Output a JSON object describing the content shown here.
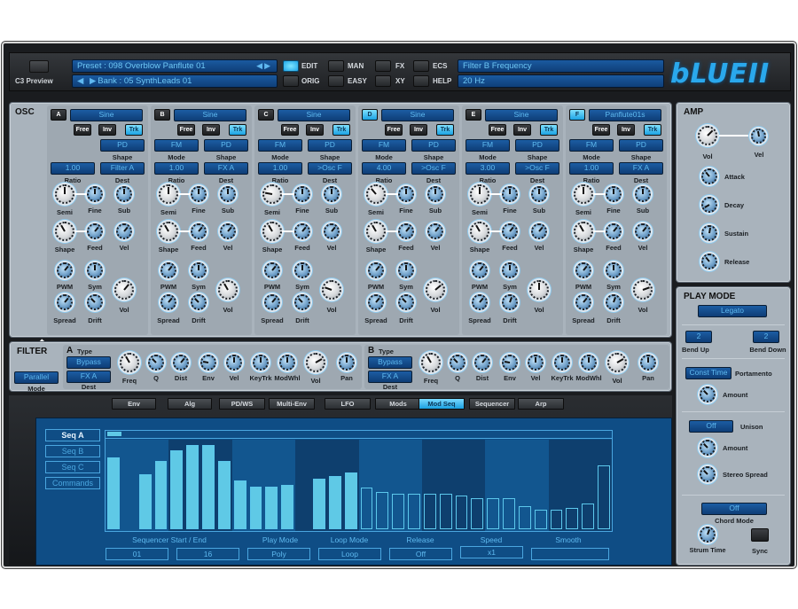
{
  "header": {
    "c3_preview_label": "C3 Preview",
    "preset": "Preset : 098 Overblow Panflute 01",
    "bank": "Bank : 05 SynthLeads 01",
    "mode_buttons": [
      {
        "label": "EDIT",
        "active": true
      },
      {
        "label": "ORIG",
        "active": false
      },
      {
        "label": "MAN",
        "active": false
      },
      {
        "label": "EASY",
        "active": false
      },
      {
        "label": "FX",
        "active": false
      },
      {
        "label": "XY",
        "active": false
      },
      {
        "label": "ECS",
        "active": false
      },
      {
        "label": "HELP",
        "active": false
      }
    ],
    "param_name": "Filter B Frequency",
    "param_value": "20 Hz",
    "logo": "bLUEII"
  },
  "osc": {
    "title": "OSC",
    "labels": {
      "free": "Free",
      "inv": "Inv",
      "trk": "Trk",
      "mode": "Mode",
      "shape": "Shape",
      "ratio": "Ratio",
      "dest": "Dest",
      "knobs": [
        "Semi",
        "Fine",
        "Sub",
        "Shape",
        "Feed",
        "Vel",
        "PWM",
        "Sym",
        "Vol",
        "Spread",
        "Drift"
      ]
    },
    "oscillators": [
      {
        "letter": "A",
        "active": false,
        "wave": "Sine",
        "mode": "",
        "shape": "PD",
        "ratio": "1.00",
        "dest": "Filter A"
      },
      {
        "letter": "B",
        "active": false,
        "wave": "Sine",
        "mode": "FM",
        "shape": "PD",
        "ratio": "1.00",
        "dest": "FX A"
      },
      {
        "letter": "C",
        "active": false,
        "wave": "Sine",
        "mode": "FM",
        "shape": "PD",
        "ratio": "1.00",
        "dest": ">Osc F"
      },
      {
        "letter": "D",
        "active": true,
        "wave": "Sine",
        "mode": "FM",
        "shape": "PD",
        "ratio": "4.00",
        "dest": ">Osc F"
      },
      {
        "letter": "E",
        "active": false,
        "wave": "Sine",
        "mode": "FM",
        "shape": "PD",
        "ratio": "3.00",
        "dest": ">Osc F"
      },
      {
        "letter": "F",
        "active": true,
        "wave": "Panflute01s",
        "mode": "FM",
        "shape": "PD",
        "ratio": "1.00",
        "dest": "FX A"
      }
    ]
  },
  "filter": {
    "title": "FILTER",
    "mode_value": "Parallel",
    "mode_label": "Mode",
    "type_label": "Type",
    "dest_label": "Dest",
    "sections": [
      {
        "letter": "A",
        "type": "Bypass",
        "dest": "FX A"
      },
      {
        "letter": "B",
        "type": "Bypass",
        "dest": "FX A"
      }
    ],
    "knobs": [
      "Freq",
      "Q",
      "Dist",
      "Env",
      "Vel",
      "KeyTrk",
      "ModWhl",
      "Vol",
      "Pan"
    ]
  },
  "tabs": [
    {
      "label": "Env",
      "active": false
    },
    {
      "label": "Alg",
      "active": false
    },
    {
      "label": "PD/WS",
      "active": false
    },
    {
      "label": "Multi-Env",
      "active": false
    },
    {
      "label": "LFO",
      "active": false
    },
    {
      "label": "Mods",
      "active": false
    },
    {
      "label": "Mod Seq",
      "active": true
    },
    {
      "label": "Sequencer",
      "active": false
    },
    {
      "label": "Arp",
      "active": false
    }
  ],
  "mod_seq": {
    "seq_buttons": [
      {
        "label": "Seq A",
        "active": true
      },
      {
        "label": "Seq B",
        "active": false
      },
      {
        "label": "Seq C",
        "active": false
      },
      {
        "label": "Commands",
        "active": false
      }
    ],
    "steps_active": 16,
    "step_values": [
      0.82,
      0,
      0.63,
      0.78,
      0.9,
      0.96,
      0.96,
      0.78,
      0.56,
      0.49,
      0.49,
      0.51,
      0,
      0.58,
      0.61,
      0.65,
      0.47,
      0.42,
      0.4,
      0.4,
      0.4,
      0.4,
      0.38,
      0.35,
      0.35,
      0.35,
      0.26,
      0.22,
      0.22,
      0.24,
      0.29,
      0.73
    ],
    "labels": {
      "start_end": "Sequencer Start / End",
      "play_mode": "Play Mode",
      "loop_mode": "Loop Mode",
      "release": "Release",
      "speed": "Speed",
      "smooth": "Smooth"
    },
    "values": {
      "start": "01",
      "end": "16",
      "play_mode": "Poly",
      "loop_mode": "Loop",
      "release": "Off",
      "speed": "x1",
      "smooth": ""
    }
  },
  "amp": {
    "title": "AMP",
    "vol": "Vol",
    "vel": "Vel",
    "envelope": [
      "Attack",
      "Decay",
      "Sustain",
      "Release"
    ]
  },
  "play_mode": {
    "title": "PLAY MODE",
    "mode_value": "Legato",
    "bend_up_value": "2",
    "bend_up_label": "Bend Up",
    "bend_down_value": "2",
    "bend_down_label": "Bend Down",
    "portamento_value": "Const Time",
    "portamento_label": "Portamento",
    "amount_label": "Amount",
    "unison_value": "Off",
    "unison_label": "Unison",
    "unison_amount_label": "Amount",
    "stereo_spread_label": "Stereo Spread",
    "chord_value": "Off",
    "chord_label": "Chord Mode",
    "strum_label": "Strum Time",
    "sync_label": "Sync"
  }
}
